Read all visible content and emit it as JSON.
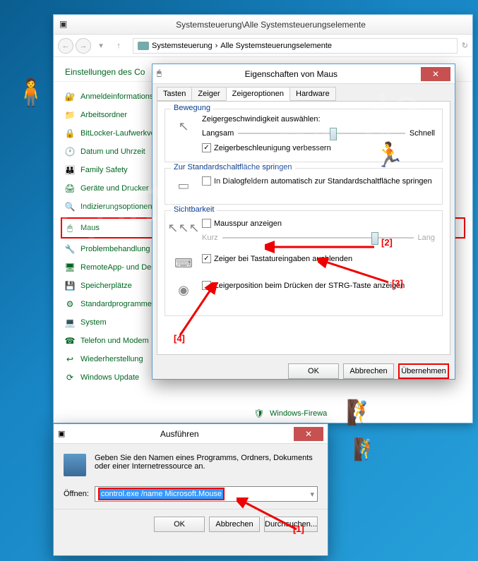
{
  "controlPanel": {
    "title": "Systemsteuerung\\Alle Systemsteuerungselemente",
    "breadcrumb": {
      "part1": "Systemsteuerung",
      "part2": "Alle Systemsteuerungselemente"
    },
    "settingsHeader": "Einstellungen des Co",
    "items": [
      {
        "label": "Anmeldeinformationsve",
        "icon": "🔐"
      },
      {
        "label": "Arbeitsordner",
        "icon": "📁"
      },
      {
        "label": "BitLocker-Laufwerkvers",
        "icon": "🔒"
      },
      {
        "label": "Datum und Uhrzeit",
        "icon": "🕐"
      },
      {
        "label": "Family Safety",
        "icon": "👪"
      },
      {
        "label": "Geräte und Drucker",
        "icon": "🖨"
      },
      {
        "label": "Indizierungsoptionen",
        "icon": "🔍"
      },
      {
        "label": "Maus",
        "icon": "🖱",
        "highlighted": true
      },
      {
        "label": "Problembehandlung",
        "icon": "🔧"
      },
      {
        "label": "RemoteApp- und Deskt",
        "icon": "🖥"
      },
      {
        "label": "Speicherplätze",
        "icon": "💾"
      },
      {
        "label": "Standardprogramme",
        "icon": "⚙"
      },
      {
        "label": "System",
        "icon": "💻"
      },
      {
        "label": "Telefon und Modem",
        "icon": "☎"
      },
      {
        "label": "Wiederherstellung",
        "icon": "↩"
      },
      {
        "label": "Windows Update",
        "icon": "⟳"
      }
    ],
    "extraItem": "Windows-Firewa"
  },
  "mouseDialog": {
    "title": "Eigenschaften von Maus",
    "tabs": [
      "Tasten",
      "Zeiger",
      "Zeigeroptionen",
      "Hardware"
    ],
    "activeTab": 2,
    "groups": {
      "motion": {
        "title": "Bewegung",
        "speedLabel": "Zeigergeschwindigkeit auswählen:",
        "slow": "Langsam",
        "fast": "Schnell",
        "enhanceLabel": "Zeigerbeschleunigung verbessern",
        "enhanceChecked": true
      },
      "snap": {
        "title": "Zur Standardschaltfläche springen",
        "label": "In Dialogfeldern automatisch zur Standardschaltfläche springen",
        "checked": false
      },
      "visibility": {
        "title": "Sichtbarkeit",
        "trailsLabel": "Mausspur anzeigen",
        "trailsChecked": false,
        "short": "Kurz",
        "long": "Lang",
        "hideLabel": "Zeiger bei Tastatureingaben ausblenden",
        "hideChecked": true,
        "ctrlLabel": "Zeigerposition beim Drücken der STRG-Taste anzeigen",
        "ctrlChecked": false
      }
    },
    "buttons": {
      "ok": "OK",
      "cancel": "Abbrechen",
      "apply": "Übernehmen"
    }
  },
  "runDialog": {
    "title": "Ausführen",
    "description": "Geben Sie den Namen eines Programms, Ordners, Dokuments oder einer Internetressource an.",
    "openLabel": "Öffnen:",
    "command": "control.exe /name Microsoft.Mouse",
    "buttons": {
      "ok": "OK",
      "cancel": "Abbrechen",
      "browse": "Durchsuchen..."
    }
  },
  "annotations": {
    "a1": "[1]",
    "a2": "[2]",
    "a3": "[3]",
    "a4": "[4]"
  },
  "watermark": "SoftwareOK.de"
}
